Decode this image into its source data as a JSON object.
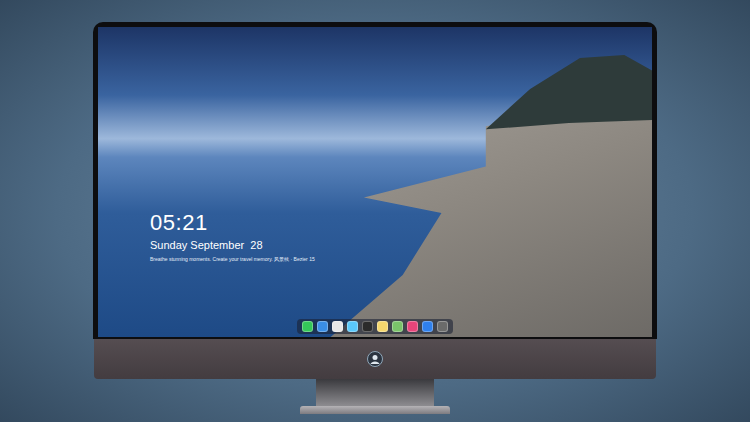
{
  "lock_screen": {
    "time": "05:21",
    "date": "Sunday September  28",
    "caption": "Breathe stunning moments. Create your travel memory. 风景线 · Bezier 15"
  },
  "dock": {
    "apps": [
      {
        "color": "#34c759"
      },
      {
        "color": "#3a8ee6"
      },
      {
        "color": "#e8e8e8"
      },
      {
        "color": "#5ac8fa"
      },
      {
        "color": "#2b2b2b"
      },
      {
        "color": "#f5d76e"
      },
      {
        "color": "#7ac36a"
      },
      {
        "color": "#e8457a"
      },
      {
        "color": "#2f80ed"
      },
      {
        "color": "#6b6b6b"
      }
    ]
  }
}
